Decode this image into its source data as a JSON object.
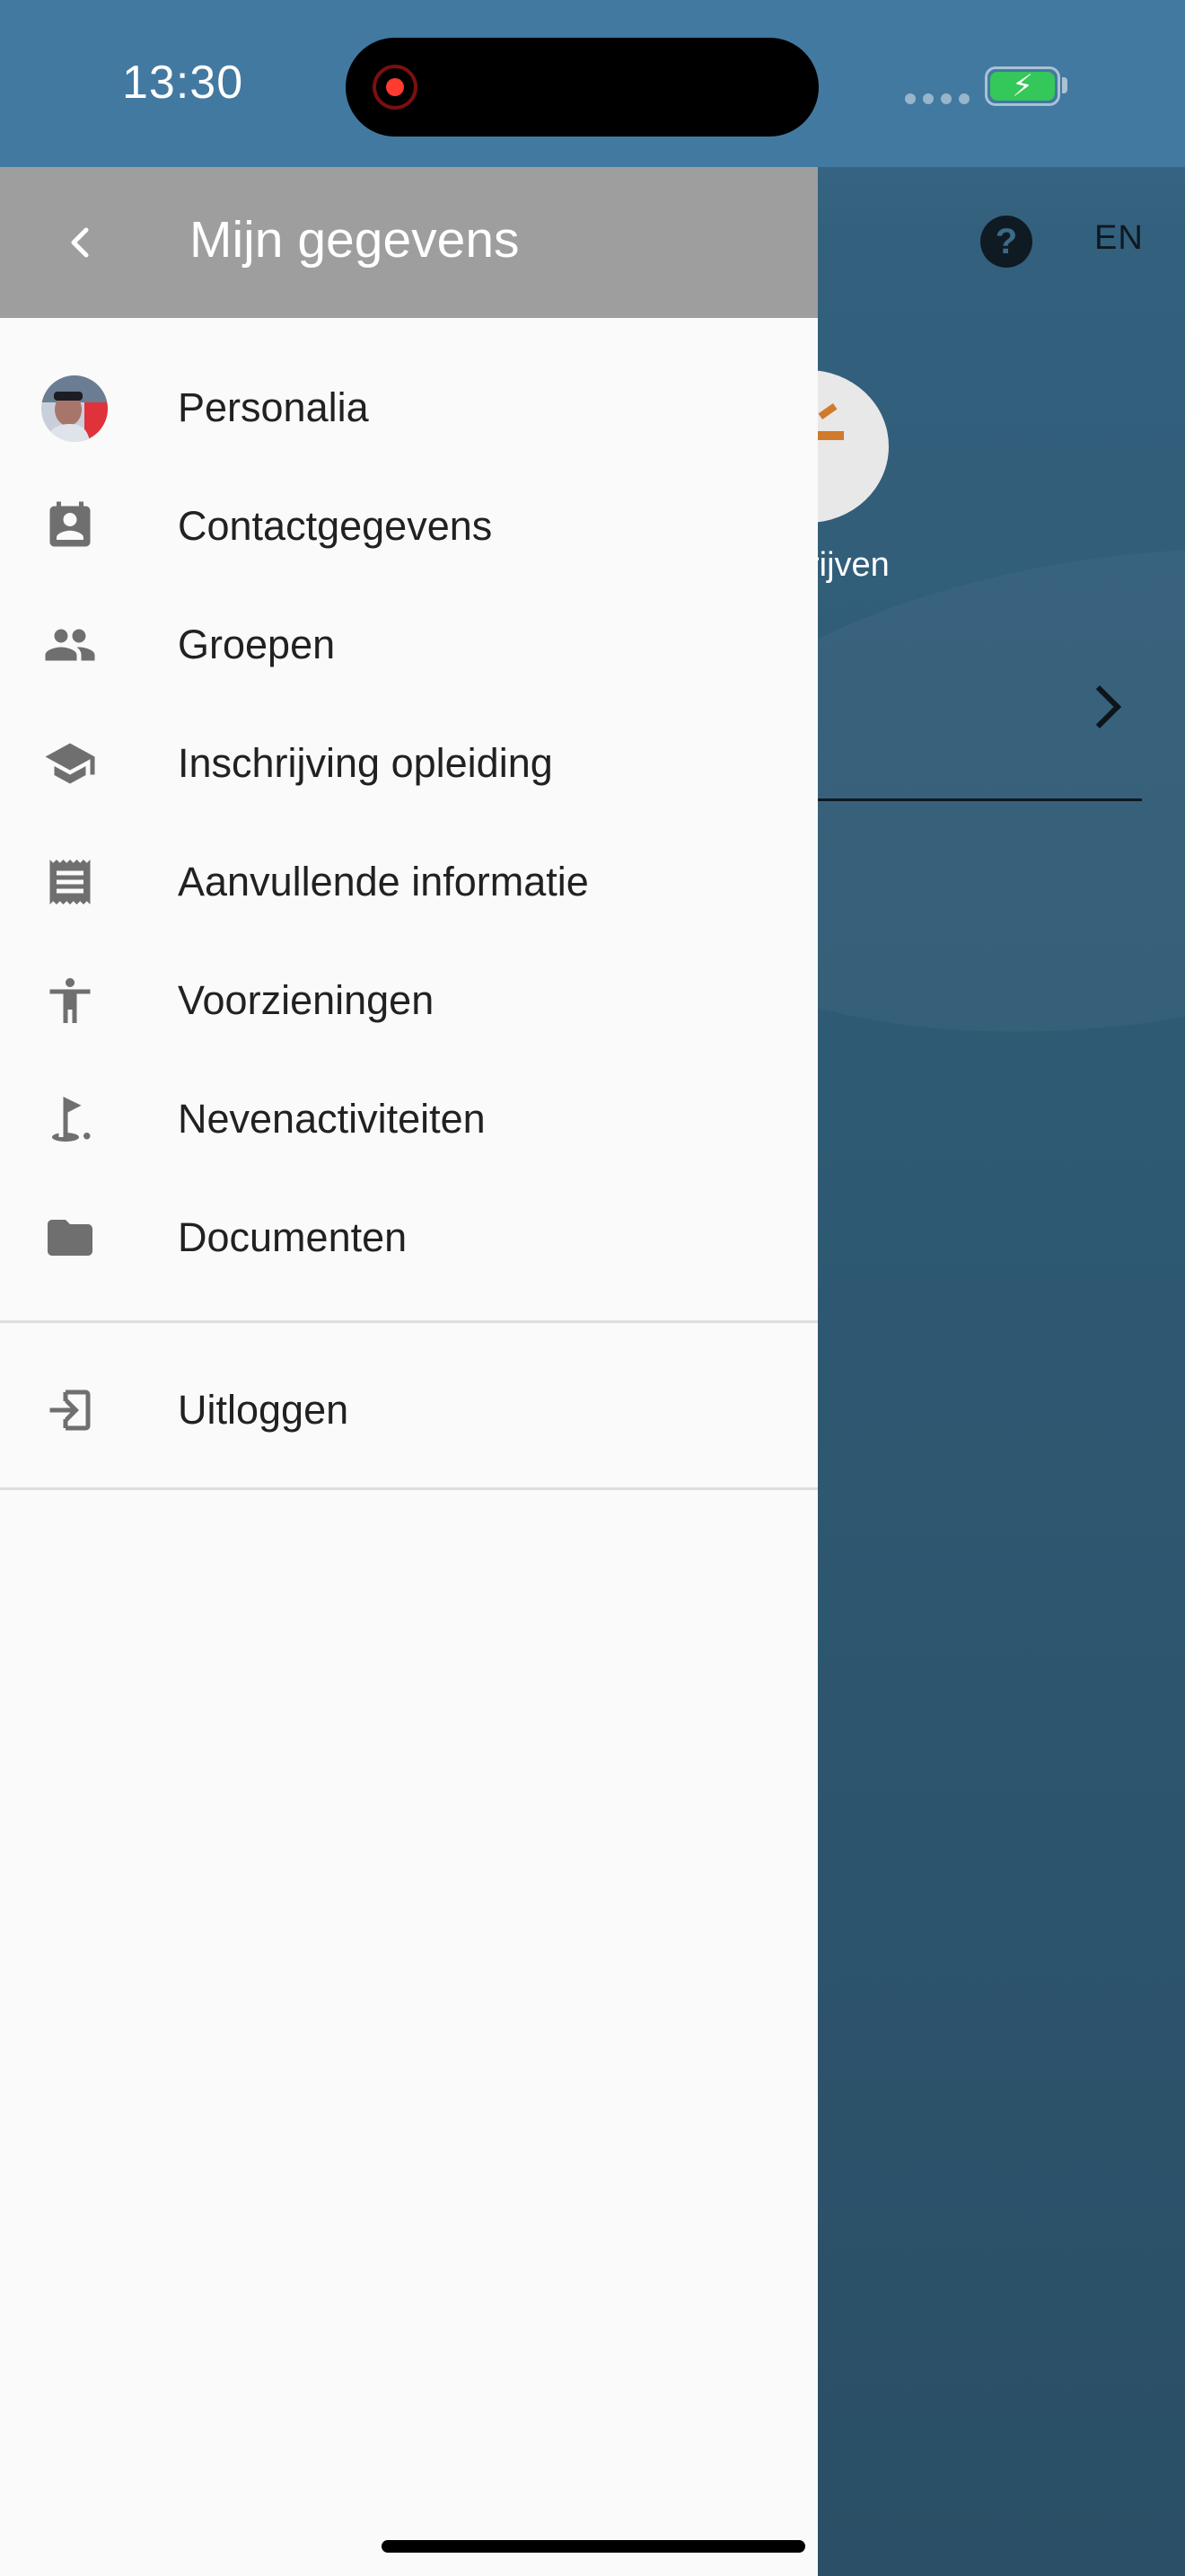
{
  "status_bar": {
    "time": "13:30"
  },
  "background_app": {
    "language_label": "EN",
    "help_glyph": "?",
    "partial_label": "rijven"
  },
  "drawer": {
    "title": "Mijn gegevens",
    "back_icon": "chevron-left-icon",
    "items": [
      {
        "label": "Personalia",
        "icon": "avatar"
      },
      {
        "label": "Contactgegevens",
        "icon": "contact-card-icon"
      },
      {
        "label": "Groepen",
        "icon": "people-icon"
      },
      {
        "label": "Inschrijving opleiding",
        "icon": "school-icon"
      },
      {
        "label": "Aanvullende informatie",
        "icon": "receipt-icon"
      },
      {
        "label": "Voorzieningen",
        "icon": "accessibility-icon"
      },
      {
        "label": "Nevenactiviteiten",
        "icon": "golf-flag-icon"
      },
      {
        "label": "Documenten",
        "icon": "folder-icon"
      }
    ],
    "logout": {
      "label": "Uitloggen",
      "icon": "logout-icon"
    }
  },
  "colors": {
    "header_gray": "#9e9e9e",
    "drawer_bg": "#fafafa",
    "icon_gray": "#6f6f6f",
    "text": "#212121",
    "status_bar_blue": "#4279a0",
    "battery_green": "#34c759"
  }
}
